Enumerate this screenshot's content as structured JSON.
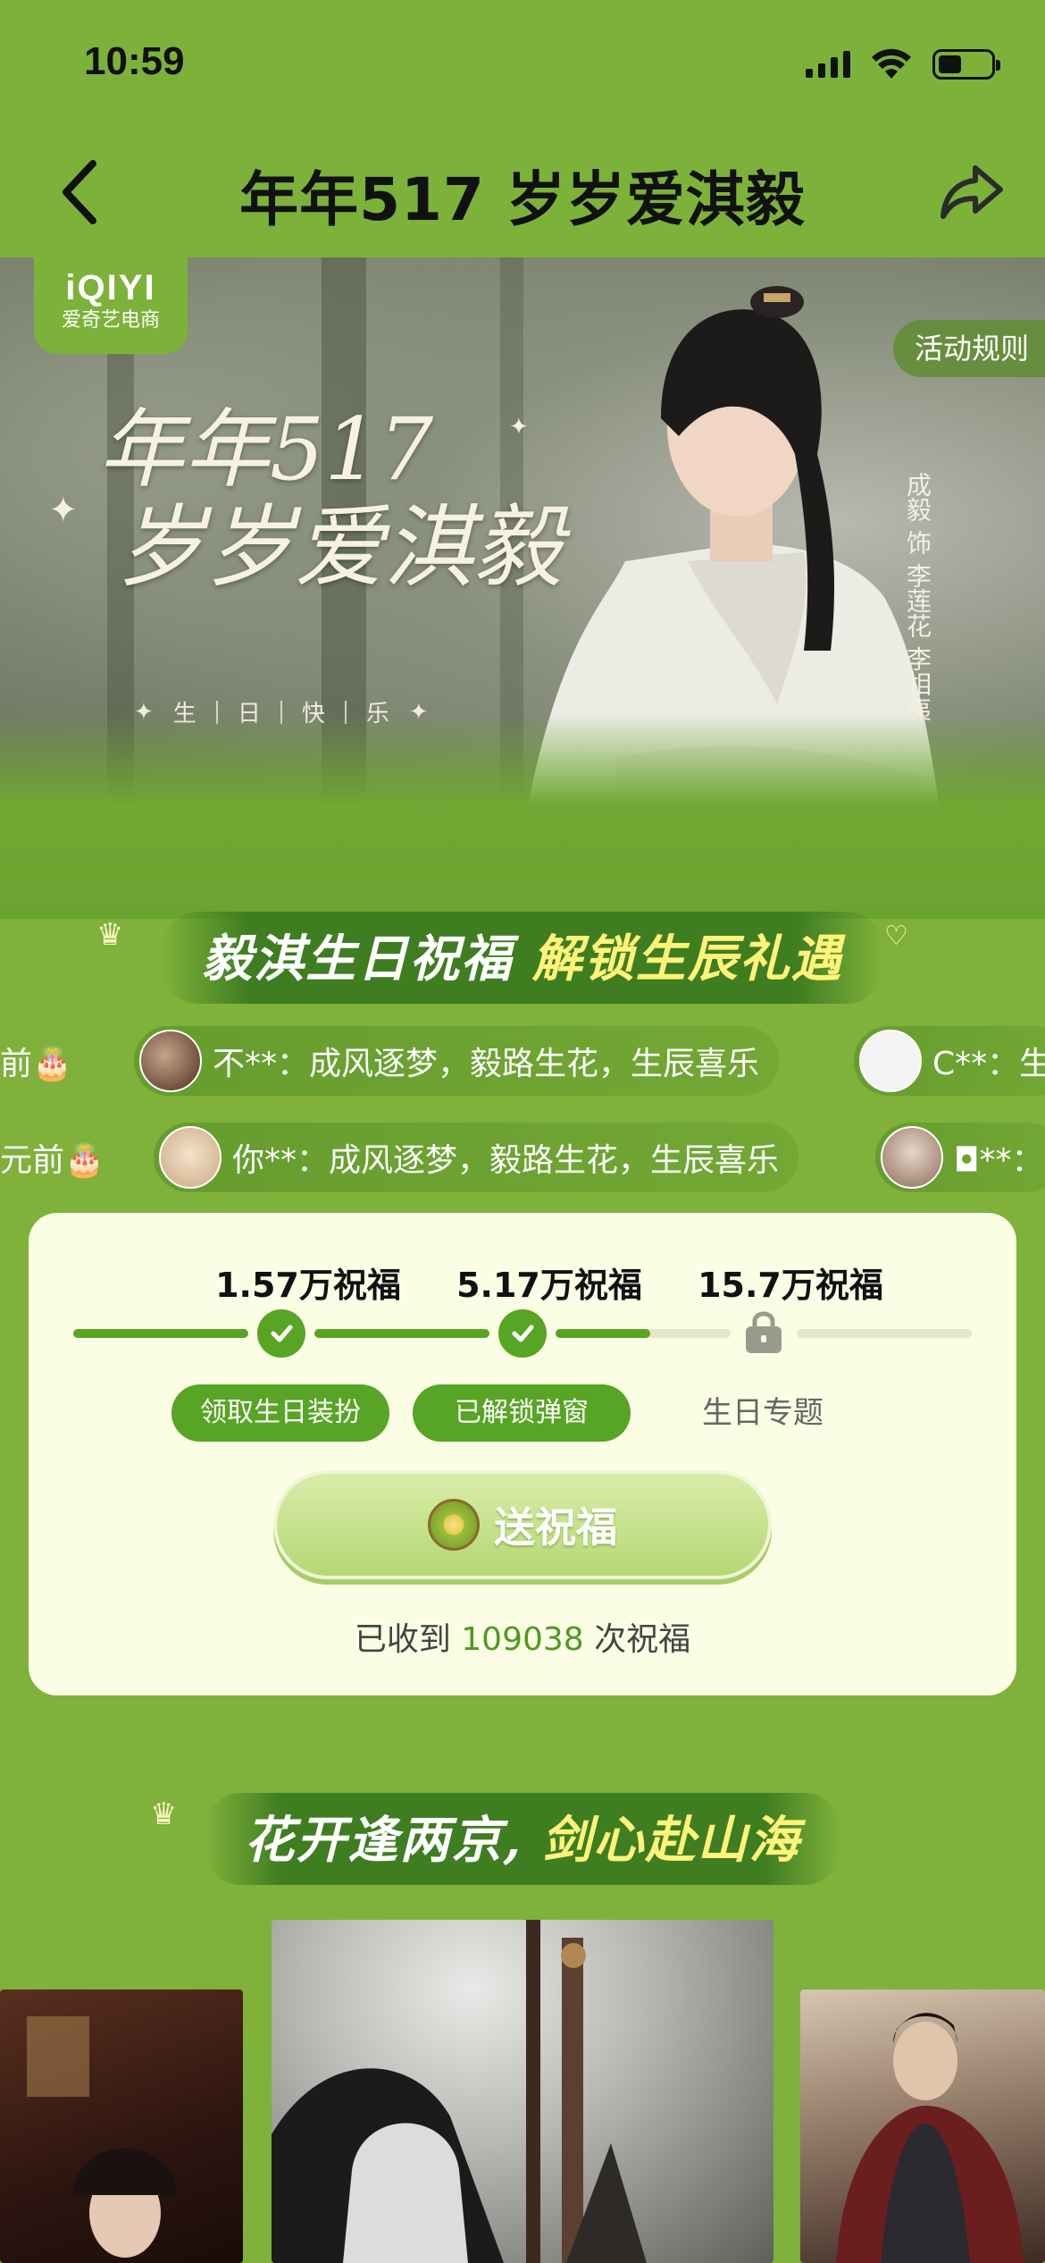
{
  "status_bar": {
    "time": "10:59"
  },
  "nav": {
    "title": "年年517 岁岁爱淇毅"
  },
  "hero": {
    "logo_line1": "iQIYI",
    "logo_line2": "爱奇艺电商",
    "rules_label": "活动规则",
    "title_line1": "年年517",
    "title_line2": "岁岁爱淇毅",
    "subtitle_chars": [
      "生",
      "日",
      "快",
      "乐"
    ],
    "credit": "成毅 饰 李莲花 李相夷"
  },
  "banner1": {
    "part1": "毅淇生日祝福",
    "part2": "解锁生辰礼遇"
  },
  "danmaku": {
    "row1": [
      {
        "text": "前🎂",
        "avatar_color": "#000000"
      },
      {
        "text": "不**：成风逐梦，毅路生花，生辰喜乐",
        "avatar_color": "#5b3a2c"
      },
      {
        "text": "C**：生",
        "avatar_color": "#f1f1f1"
      }
    ],
    "row2": [
      {
        "text": "元前🎂",
        "avatar_color": "#000000"
      },
      {
        "text": "你**：成风逐梦，毅路生花，生辰喜乐",
        "avatar_color": "#e9d7c0"
      },
      {
        "text": "◘**：",
        "avatar_color": "#b99a86"
      }
    ]
  },
  "progress": {
    "milestones": [
      "1.57万祝福",
      "5.17万祝福",
      "15.7万祝福"
    ],
    "rewards": [
      {
        "label": "领取生日装扮",
        "unlocked": true
      },
      {
        "label": "已解锁弹窗",
        "unlocked": true
      },
      {
        "label": "生日专题",
        "unlocked": false
      }
    ],
    "send_button": "送祝福",
    "received_prefix": "已收到",
    "received_count": "109038",
    "received_suffix": "次祝福",
    "received_value": 109038
  },
  "banner2": {
    "part1": "花开逢两京,",
    "part2": "剑心赴山海"
  },
  "colors": {
    "brand_green": "#7db23a",
    "accent_green": "#58a424",
    "card_bg": "#fbfde4",
    "highlight_yellow": "#fff37a"
  },
  "icons": [
    "back-chevron-icon",
    "share-icon",
    "wifi-icon",
    "signal-icon",
    "battery-icon",
    "check-icon",
    "lock-icon",
    "kiwi-icon",
    "crown-icon",
    "heart-icon",
    "sparkle-icon"
  ]
}
